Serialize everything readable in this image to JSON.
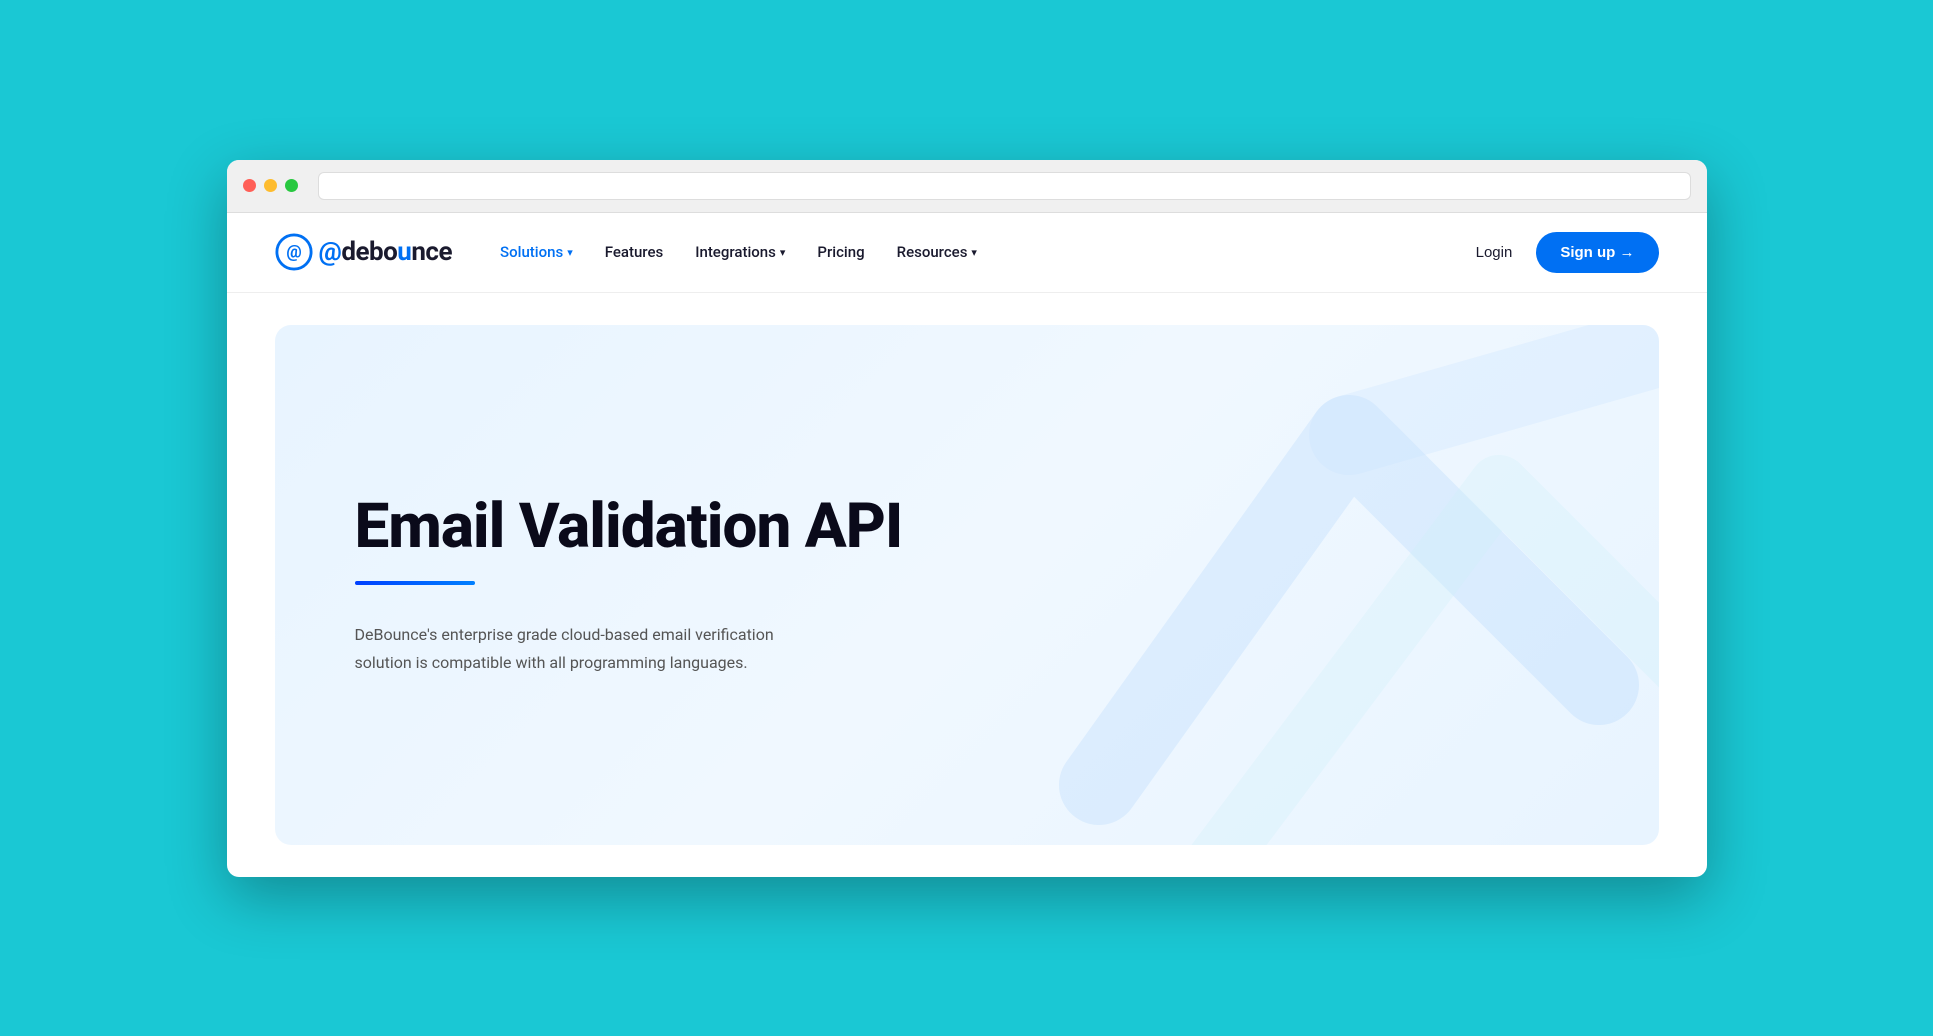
{
  "browser": {
    "traffic_lights": [
      "red",
      "yellow",
      "green"
    ]
  },
  "navbar": {
    "logo_text": "@deboʌnce",
    "nav_items": [
      {
        "label": "Solutions",
        "has_dropdown": true,
        "active": true
      },
      {
        "label": "Features",
        "has_dropdown": false,
        "active": false
      },
      {
        "label": "Integrations",
        "has_dropdown": true,
        "active": false
      },
      {
        "label": "Pricing",
        "has_dropdown": false,
        "active": false
      },
      {
        "label": "Resources",
        "has_dropdown": true,
        "active": false
      }
    ],
    "login_label": "Login",
    "signup_label": "Sign up →"
  },
  "hero": {
    "title": "Email Validation API",
    "description": "DeBounce's enterprise grade cloud-based email verification solution is compatible with all programming languages."
  },
  "colors": {
    "primary": "#0070f3",
    "teal": "#1ac8d4",
    "dark": "#0a0a1a",
    "text_gray": "#555"
  }
}
